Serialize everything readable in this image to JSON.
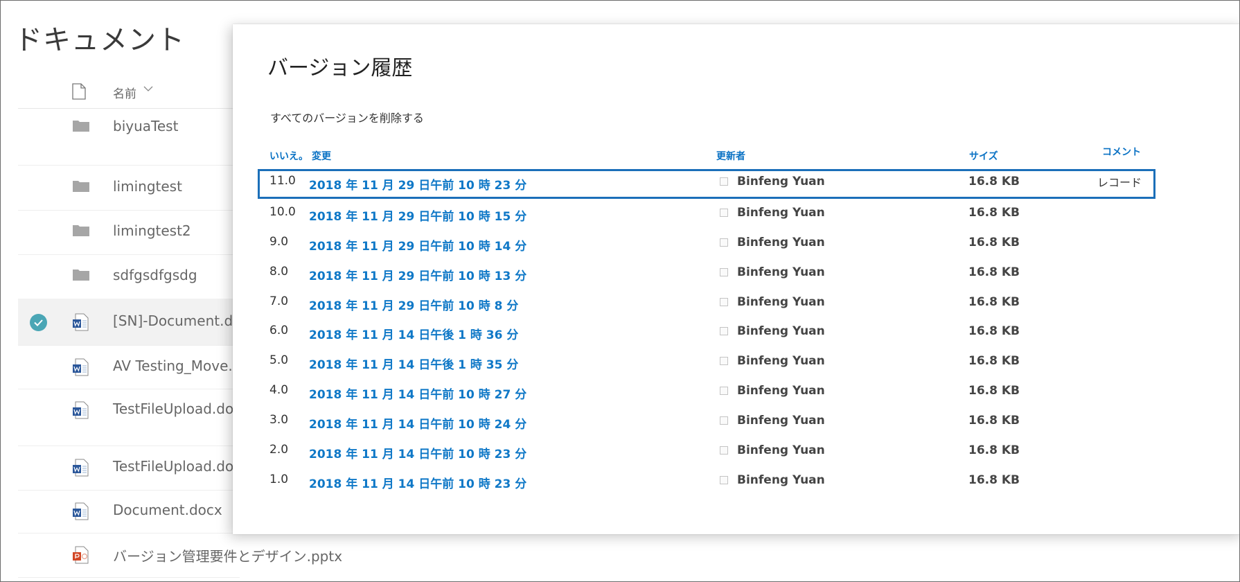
{
  "library": {
    "title": "ドキュメント",
    "header": {
      "name_label": "名前"
    },
    "items": [
      {
        "name": "biyuaTest",
        "type": "folder",
        "selected": false
      },
      {
        "name": "limingtest",
        "type": "folder",
        "selected": false
      },
      {
        "name": "limingtest2",
        "type": "folder",
        "selected": false
      },
      {
        "name": "sdfgsdfgsdg",
        "type": "folder",
        "selected": false
      },
      {
        "name": "[SN]-Document.do",
        "type": "word",
        "selected": true
      },
      {
        "name": "AV Testing_Move.",
        "type": "word",
        "selected": false
      },
      {
        "name": "TestFileUpload.do",
        "type": "word",
        "selected": false
      },
      {
        "name": "TestFileUpload.do",
        "type": "word",
        "selected": false
      },
      {
        "name": "Document.docx",
        "type": "word",
        "selected": false
      },
      {
        "name": "バージョン管理要件とデザイン.pptx",
        "type": "powerpoint",
        "selected": false
      }
    ]
  },
  "version_history": {
    "title": "バージョン履歴",
    "delete_all_label": "すべてのバージョンを削除する",
    "columns": {
      "no": "いいえ。",
      "modified": "変更",
      "modified_by": "更新者",
      "size": "サイズ",
      "comment": "コメント"
    },
    "rows": [
      {
        "version": "11.0",
        "date": "2018 年 11 月 29 日午前 10 時 23 分",
        "modified_by": "Binfeng Yuan",
        "size": "16.8 KB",
        "comment": "レコード",
        "focused": true
      },
      {
        "version": "10.0",
        "date": "2018 年 11 月 29 日午前 10 時 15 分",
        "modified_by": "Binfeng Yuan",
        "size": "16.8 KB",
        "comment": "",
        "focused": false
      },
      {
        "version": "9.0",
        "date": "2018 年 11 月 29 日午前 10 時 14 分",
        "modified_by": "Binfeng Yuan",
        "size": "16.8 KB",
        "comment": "",
        "focused": false
      },
      {
        "version": "8.0",
        "date": "2018 年 11 月 29 日午前 10 時 13 分",
        "modified_by": "Binfeng Yuan",
        "size": "16.8 KB",
        "comment": "",
        "focused": false
      },
      {
        "version": "7.0",
        "date": "2018 年 11 月 29 日午前 10 時 8 分",
        "modified_by": "Binfeng Yuan",
        "size": "16.8 KB",
        "comment": "",
        "focused": false
      },
      {
        "version": "6.0",
        "date": "2018 年 11 月 14 日午後 1 時 36 分",
        "modified_by": "Binfeng Yuan",
        "size": "16.8 KB",
        "comment": "",
        "focused": false
      },
      {
        "version": "5.0",
        "date": "2018 年 11 月 14 日午後 1 時 35 分",
        "modified_by": "Binfeng Yuan",
        "size": "16.8 KB",
        "comment": "",
        "focused": false
      },
      {
        "version": "4.0",
        "date": "2018 年 11 月 14 日午前 10 時 27 分",
        "modified_by": "Binfeng Yuan",
        "size": "16.8 KB",
        "comment": "",
        "focused": false
      },
      {
        "version": "3.0",
        "date": "2018 年 11 月 14 日午前 10 時 24 分",
        "modified_by": "Binfeng Yuan",
        "size": "16.8 KB",
        "comment": "",
        "focused": false
      },
      {
        "version": "2.0",
        "date": "2018 年 11 月 14 日午前 10 時 23 分",
        "modified_by": "Binfeng Yuan",
        "size": "16.8 KB",
        "comment": "",
        "focused": false
      },
      {
        "version": "1.0",
        "date": "2018 年 11 月 14 日午前 10 時 23 分",
        "modified_by": "Binfeng Yuan",
        "size": "16.8 KB",
        "comment": "",
        "focused": false
      }
    ]
  },
  "colors": {
    "link": "#0f78c7",
    "focus_border": "#1b6fb9",
    "selected_check": "#4aa6b5",
    "folder": "#a6a6a6",
    "word": "#2b579a",
    "powerpoint": "#d24726"
  }
}
